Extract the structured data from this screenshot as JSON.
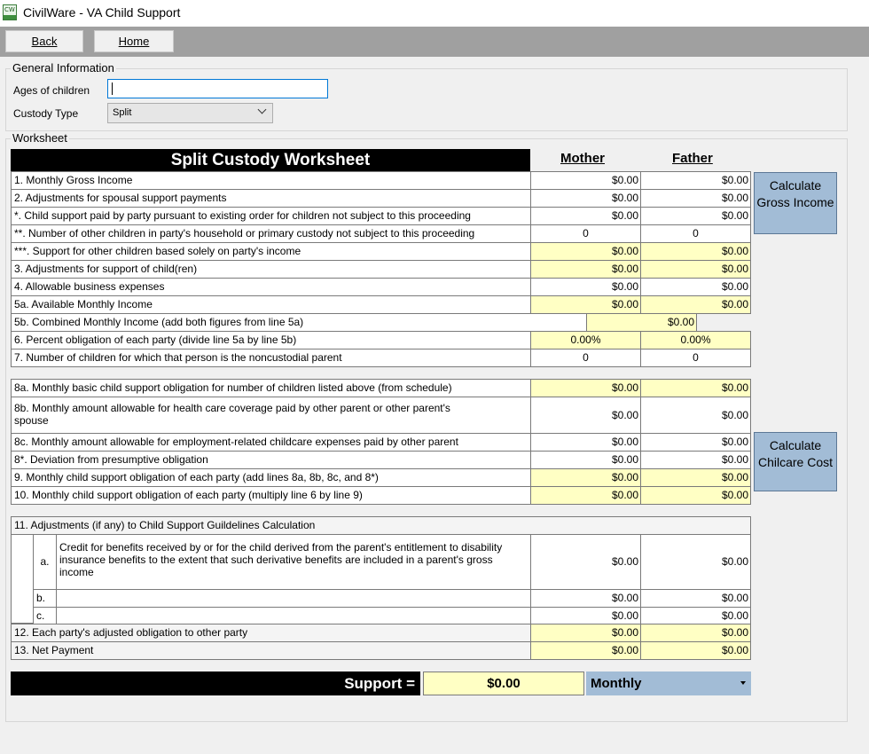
{
  "window": {
    "title": "CivilWare - VA Child Support",
    "icon_text": "CW"
  },
  "toolbar": {
    "back_label": "Back",
    "home_label": "Home"
  },
  "general": {
    "group_label": "General Information",
    "ages_label": "Ages of children",
    "ages_value": "",
    "custody_label": "Custody Type",
    "custody_value": "Split"
  },
  "worksheet": {
    "group_label": "Worksheet",
    "title": "Split Custody Worksheet",
    "mother_header": "Mother",
    "father_header": "Father",
    "calc_gross_label": "Calculate Gross Income",
    "calc_childcare_label": "Calculate Chilcare Cost",
    "rows": [
      {
        "label": "1. Monthly Gross Income",
        "mother": "$0.00",
        "father": "$0.00"
      },
      {
        "label": "2. Adjustments for spousal support payments",
        "mother": "$0.00",
        "father": "$0.00"
      },
      {
        "label": "*. Child support paid by party pursuant to existing order for children not subject to this proceeding",
        "mother": "$0.00",
        "father": "$0.00"
      },
      {
        "label": "**. Number of other children in party's household or primary custody not subject to this proceeding",
        "mother": "0",
        "father": "0"
      },
      {
        "label": "***. Support for other children based solely on party's income",
        "mother": "$0.00",
        "father": "$0.00"
      },
      {
        "label": "3. Adjustments for support of child(ren)",
        "mother": "$0.00",
        "father": "$0.00"
      },
      {
        "label": "4. Allowable business expenses",
        "mother": "$0.00",
        "father": "$0.00"
      },
      {
        "label": "5a. Available Monthly Income",
        "mother": "$0.00",
        "father": "$0.00"
      },
      {
        "label": "5b. Combined Monthly Income (add both figures from line 5a)",
        "combined": "$0.00"
      },
      {
        "label": "6. Percent obligation of each party (divide line 5a by line 5b)",
        "mother": "0.00%",
        "father": "0.00%"
      },
      {
        "label": "7. Number of children for which that person is the noncustodial parent",
        "mother": "0",
        "father": "0"
      },
      {
        "label": "8a. Monthly basic child support obligation for number of children listed above (from schedule)",
        "mother": "$0.00",
        "father": "$0.00"
      },
      {
        "label": "8b. Monthly amount allowable for health care coverage paid by other parent or other parent's spouse",
        "mother": "$0.00",
        "father": "$0.00"
      },
      {
        "label": "8c. Monthly amount allowable for employment-related childcare expenses paid by other parent",
        "mother": "$0.00",
        "father": "$0.00"
      },
      {
        "label": "8*. Deviation from presumptive obligation",
        "mother": "$0.00",
        "father": "$0.00"
      },
      {
        "label": "9. Monthly child support obligation of each party (add lines 8a, 8b, 8c, and 8*)",
        "mother": "$0.00",
        "father": "$0.00"
      },
      {
        "label": "10. Monthly child support obligation of each party (multiply line 6 by line 9)",
        "mother": "$0.00",
        "father": "$0.00"
      }
    ],
    "adjustments": {
      "header": "11. Adjustments (if any) to Child Support Guildelines Calculation",
      "a_letter": "a.",
      "a_text": "Credit for benefits received by or for the child derived from the parent's entitlement to disability insurance benefits to the extent that such derivative benefits are included in a parent's gross income",
      "a_mother": "$0.00",
      "a_father": "$0.00",
      "b_letter": "b.",
      "b_mother": "$0.00",
      "b_father": "$0.00",
      "c_letter": "c.",
      "c_mother": "$0.00",
      "c_father": "$0.00"
    },
    "row12": {
      "label": "12. Each party's adjusted obligation to other party",
      "mother": "$0.00",
      "father": "$0.00"
    },
    "row13": {
      "label": "13. Net Payment",
      "mother": "$0.00",
      "father": "$0.00"
    }
  },
  "support": {
    "label": "Support =",
    "value": "$0.00",
    "frequency": "Monthly"
  },
  "colors": {
    "yellow_cell": "#ffffc4",
    "button_blue": "#a2bcd6",
    "toolbar_gray": "#a0a0a0"
  }
}
